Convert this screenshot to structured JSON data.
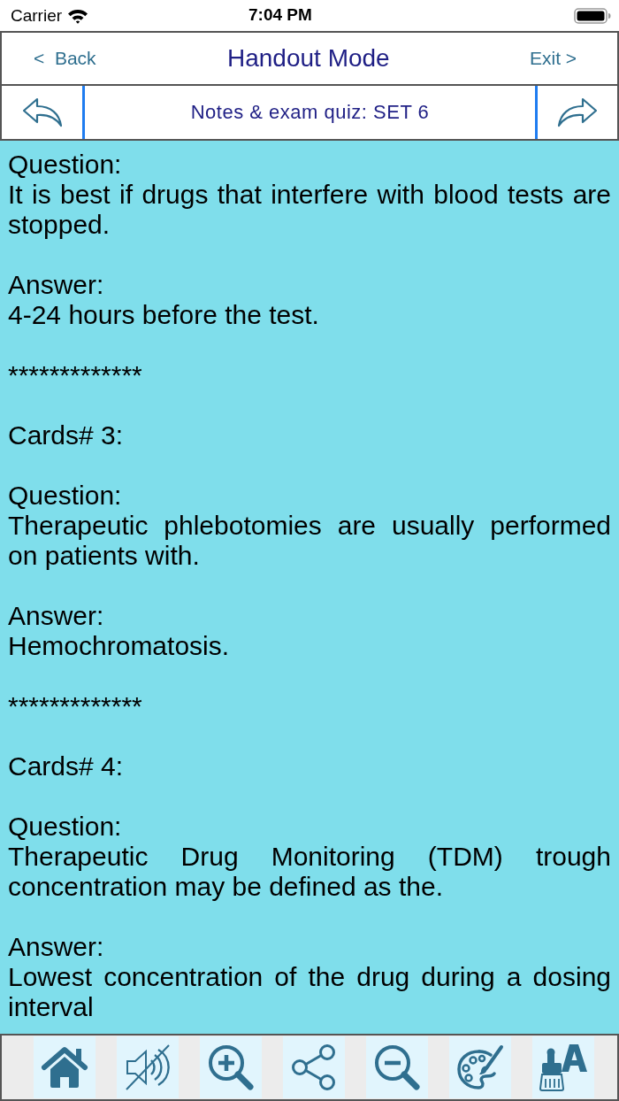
{
  "status_bar": {
    "carrier": "Carrier",
    "time": "7:04 PM"
  },
  "nav_bar": {
    "back": "<  Back",
    "title": "Handout Mode",
    "exit": "Exit >"
  },
  "set_bar": {
    "title": "Notes & exam quiz: SET 6"
  },
  "cards": [
    {
      "question_label": "Question:",
      "question": "It is best if drugs that interfere with blood tests are stopped.",
      "answer_label": "Answer:",
      "answer": "4-24 hours before the test.",
      "separator": "*************"
    },
    {
      "heading": "Cards# 3:",
      "question_label": "Question:",
      "question": "Therapeutic phlebotomies are usually performed on patients with.",
      "answer_label": "Answer:",
      "answer": "Hemochromatosis.",
      "separator": "*************"
    },
    {
      "heading": "Cards# 4:",
      "question_label": "Question:",
      "question": "Therapeutic Drug Monitoring (TDM) trough concentration may be defined as the.",
      "answer_label": "Answer:",
      "answer": "Lowest concentration of the drug during a dosing interval"
    }
  ]
}
